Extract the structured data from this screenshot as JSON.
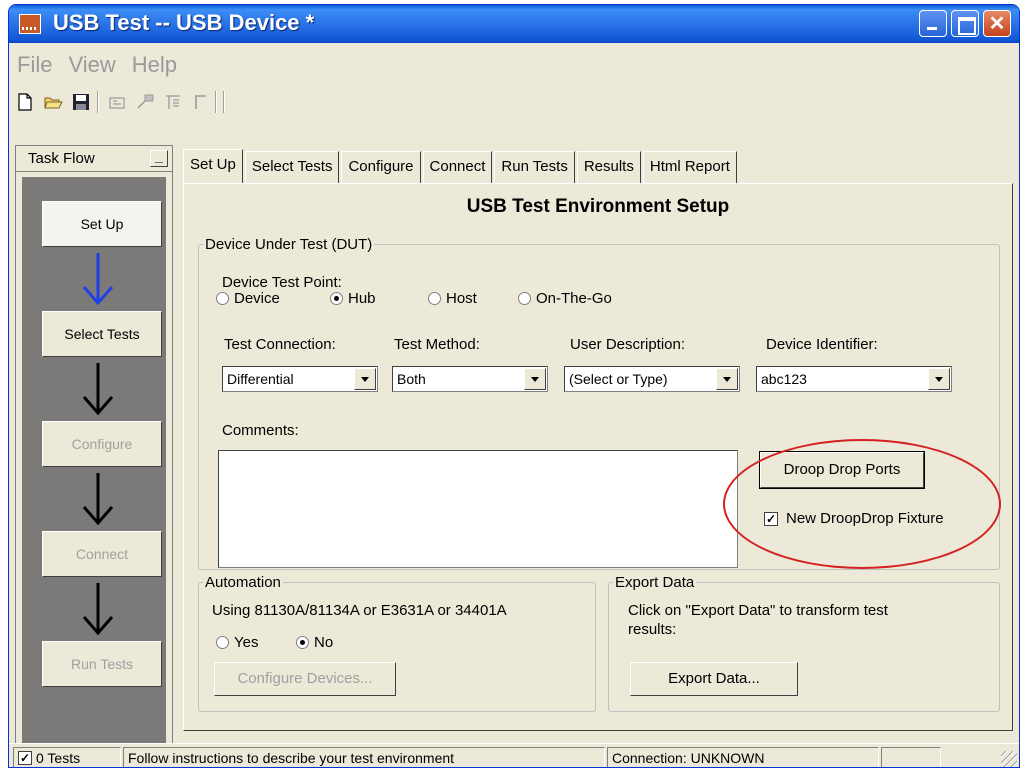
{
  "window": {
    "title": "USB Test -- USB Device *"
  },
  "menu": [
    "File",
    "View",
    "Help"
  ],
  "toolbar": {
    "icons": [
      "new-file-icon",
      "open-folder-icon",
      "save-icon",
      "tool-icon-1",
      "tool-icon-2",
      "tool-icon-3",
      "tool-icon-4"
    ]
  },
  "task_flow": {
    "header": "Task Flow",
    "steps": [
      "Set Up",
      "Select Tests",
      "Configure",
      "Connect",
      "Run Tests"
    ]
  },
  "tabs": [
    "Set Up",
    "Select Tests",
    "Configure",
    "Connect",
    "Run Tests",
    "Results",
    "Html Report"
  ],
  "main": {
    "title": "USB Test Environment Setup",
    "dut": {
      "legend": "Device Under Test (DUT)",
      "test_point_label": "Device Test Point:",
      "test_points": [
        "Device",
        "Hub",
        "Host",
        "On-The-Go"
      ],
      "selected_test_point": "Hub",
      "test_connection_label": "Test Connection:",
      "test_connection_value": "Differential",
      "test_method_label": "Test Method:",
      "test_method_value": "Both",
      "user_description_label": "User Description:",
      "user_description_value": "(Select or Type)",
      "device_identifier_label": "Device Identifier:",
      "device_identifier_value": "abc123",
      "comments_label": "Comments:",
      "droop_button": "Droop Drop Ports",
      "droop_fixture_label": "New DroopDrop Fixture",
      "droop_fixture_checked": true
    },
    "automation": {
      "legend": "Automation",
      "text": "Using 81130A/81134A or E3631A or 34401A",
      "yes": "Yes",
      "no": "No",
      "selected": "No",
      "configure_button": "Configure Devices..."
    },
    "export": {
      "legend": "Export Data",
      "text_line1": "Click on \"Export Data\" to transform test",
      "text_line2": "results:",
      "button": "Export Data..."
    }
  },
  "status": {
    "tests": "0 Tests",
    "message": "Follow instructions to describe your test environment",
    "connection": "Connection: UNKNOWN"
  },
  "colors": {
    "title_bar": "#2a73e6",
    "window_bg": "#ece9d8",
    "task_flow_bg": "#7c7a78",
    "active_arrow": "#1f3fe8",
    "highlight_ellipse": "#d42020"
  }
}
